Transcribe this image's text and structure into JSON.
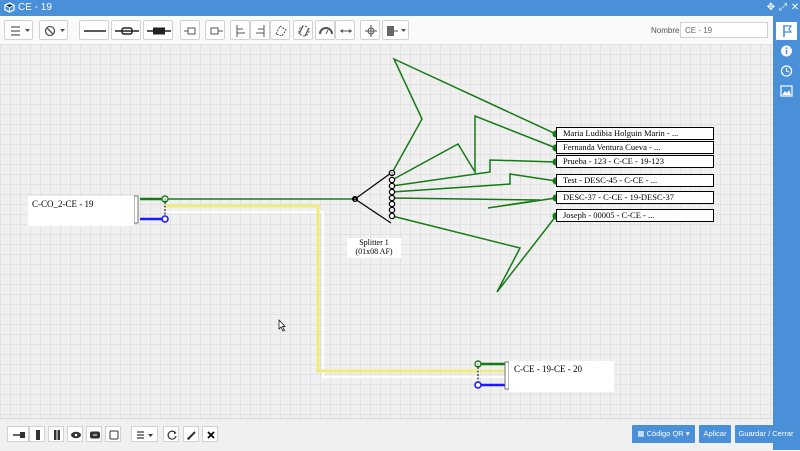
{
  "window": {
    "title": "CE - 19"
  },
  "toolbar": {
    "name_label": "Nombre:",
    "name_value": "CE - 19",
    "icons": [
      "list-icon",
      "ban-icon",
      "line-style-thin-icon",
      "cable-splice-icon",
      "cable-connector-icon",
      "pin-left-icon",
      "pin-right-icon",
      "align-left-icon",
      "align-center-icon",
      "rotate-icon",
      "link-icon",
      "gauge-icon",
      "arrows-horizontal-icon",
      "move-icon",
      "export-icon"
    ]
  },
  "canvas": {
    "left_box_label": "C-CO_2-CE - 19",
    "right_box_label": "C-CE - 19-CE - 20",
    "splitter": {
      "name": "Splitter 1",
      "spec": "(01x08 AF)",
      "port_top": "1",
      "port_in": "1"
    },
    "fiber_labels": [
      "Maria Ludibia Holguin Marin - ...",
      "Fernanda Ventura Cueva - ...",
      "Prueba - 123 - C-CE - 19-123",
      "Test - DESC-45 - C-CE - ...",
      "DESC-37 - C-CE - 19-DESC-37",
      "Joseph - 00005 - C-CE - ..."
    ],
    "colors": {
      "green": "#157a15",
      "yellow": "#f0ec7a",
      "blue": "#1a1aff",
      "white_fiber": "#ffffff",
      "accent": "#4a90d9"
    }
  },
  "bottom": {
    "qr_label": "Código QR",
    "apply_label": "Aplicar",
    "save_label": "Guardar / Cerrar"
  }
}
